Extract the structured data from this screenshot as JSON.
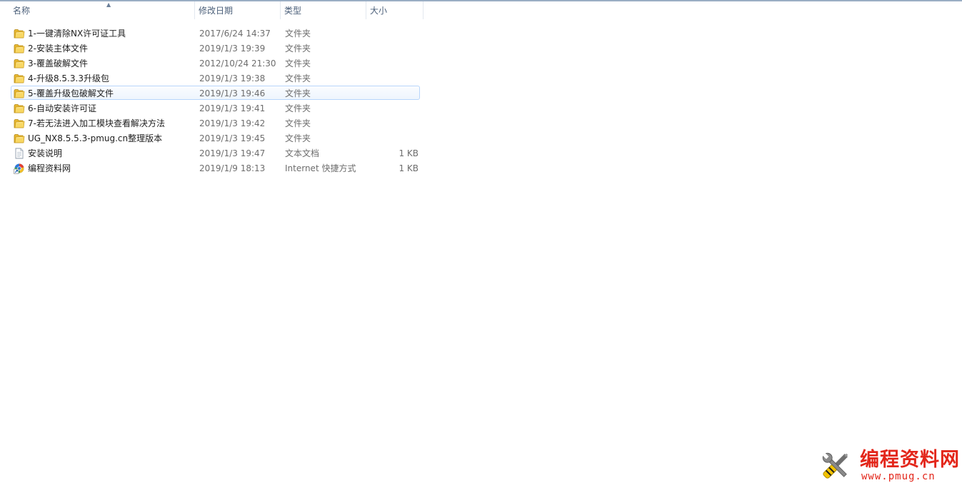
{
  "columns": {
    "name": "名称",
    "date": "修改日期",
    "type": "类型",
    "size": "大小"
  },
  "files": [
    {
      "name": "1-一键清除NX许可证工具",
      "date": "2017/6/24 14:37",
      "type": "文件夹",
      "size": "",
      "icon": "folder-icon",
      "selected": false
    },
    {
      "name": "2-安装主体文件",
      "date": "2019/1/3 19:39",
      "type": "文件夹",
      "size": "",
      "icon": "folder-icon",
      "selected": false
    },
    {
      "name": "3-覆盖破解文件",
      "date": "2012/10/24 21:30",
      "type": "文件夹",
      "size": "",
      "icon": "folder-icon",
      "selected": false
    },
    {
      "name": "4-升级8.5.3.3升级包",
      "date": "2019/1/3 19:38",
      "type": "文件夹",
      "size": "",
      "icon": "folder-icon",
      "selected": false
    },
    {
      "name": "5-覆盖升级包破解文件",
      "date": "2019/1/3 19:46",
      "type": "文件夹",
      "size": "",
      "icon": "folder-icon",
      "selected": true
    },
    {
      "name": "6-自动安装许可证",
      "date": "2019/1/3 19:41",
      "type": "文件夹",
      "size": "",
      "icon": "folder-icon",
      "selected": false
    },
    {
      "name": "7-若无法进入加工模块查看解决方法",
      "date": "2019/1/3 19:42",
      "type": "文件夹",
      "size": "",
      "icon": "folder-icon",
      "selected": false
    },
    {
      "name": "UG_NX8.5.5.3-pmug.cn整理版本",
      "date": "2019/1/3 19:45",
      "type": "文件夹",
      "size": "",
      "icon": "folder-icon",
      "selected": false
    },
    {
      "name": "安装说明",
      "date": "2019/1/3 19:47",
      "type": "文本文档",
      "size": "1 KB",
      "icon": "text-document-icon",
      "selected": false
    },
    {
      "name": "编程资料网",
      "date": "2019/1/9 18:13",
      "type": "Internet 快捷方式",
      "size": "1 KB",
      "icon": "internet-shortcut-icon",
      "selected": false
    }
  ],
  "watermark": {
    "title": "编程资料网",
    "url": "www.pmug.cn",
    "icon": "tools-icon"
  },
  "colors": {
    "selection_border": "#b8d6fb",
    "header_text": "#4c607a",
    "watermark": "#e3261a"
  }
}
